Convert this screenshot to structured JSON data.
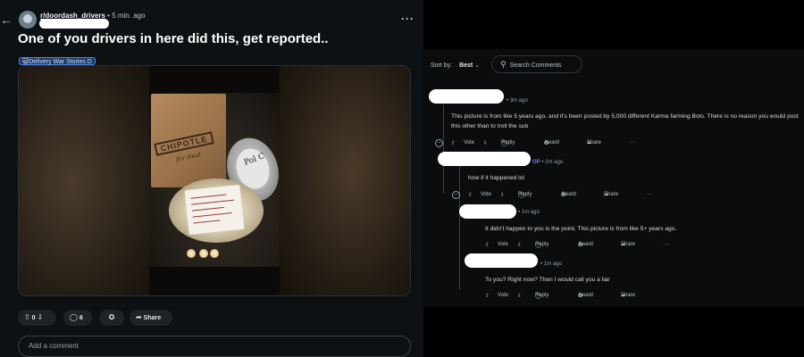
{
  "post": {
    "subreddit": "r/doordash_drivers",
    "age": "5 min. ago",
    "title": "One of you drivers in here did this, get reported..",
    "flair": "Delivery War Stories",
    "flair_icon": "🙀",
    "flair_suffix": "D",
    "photo": {
      "bag_label": "CHIPOTLE",
      "bag_script": "for Real",
      "bowl_text": "Pol C"
    },
    "actions": {
      "vote_count": "0",
      "comment_count": "6",
      "share_label": "Share"
    },
    "comment_placeholder": "Add a comment"
  },
  "comments_header": {
    "sort_label": "Sort by:",
    "sort_value": "Best",
    "search_placeholder": "Search Comments"
  },
  "comments": [
    {
      "meta_suffix": "• 3m ago",
      "is_op": false,
      "text": "This picture is from like 5 years ago, and it's been posted by 5,000 different Karma farming Bots. There is no reason you would post this other than to troll the sub",
      "actions": [
        "Vote",
        "Reply",
        "Award",
        "Share",
        "···"
      ]
    },
    {
      "op_label": "OP",
      "meta_suffix": "• 2m ago",
      "is_op": true,
      "text": "how if it happened lol",
      "actions": [
        "Vote",
        "Reply",
        "Award",
        "Share",
        "···"
      ]
    },
    {
      "meta_suffix": "• 1m ago",
      "is_op": false,
      "text": "It didn't happen to you is the point. This picture is from like 5+ years ago.",
      "actions": [
        "Vote",
        "Reply",
        "Award",
        "Share",
        "···"
      ]
    },
    {
      "meta_suffix": "• 1m ago",
      "is_op": false,
      "text": "To you? Right now? Then I would call you a liar",
      "actions": [
        "Vote",
        "Reply",
        "Award",
        "Share"
      ]
    }
  ],
  "colors": {
    "panel_bg": "#0e1113",
    "op_blue": "#4f8ff7",
    "flair_bg": "#1d3a66"
  }
}
